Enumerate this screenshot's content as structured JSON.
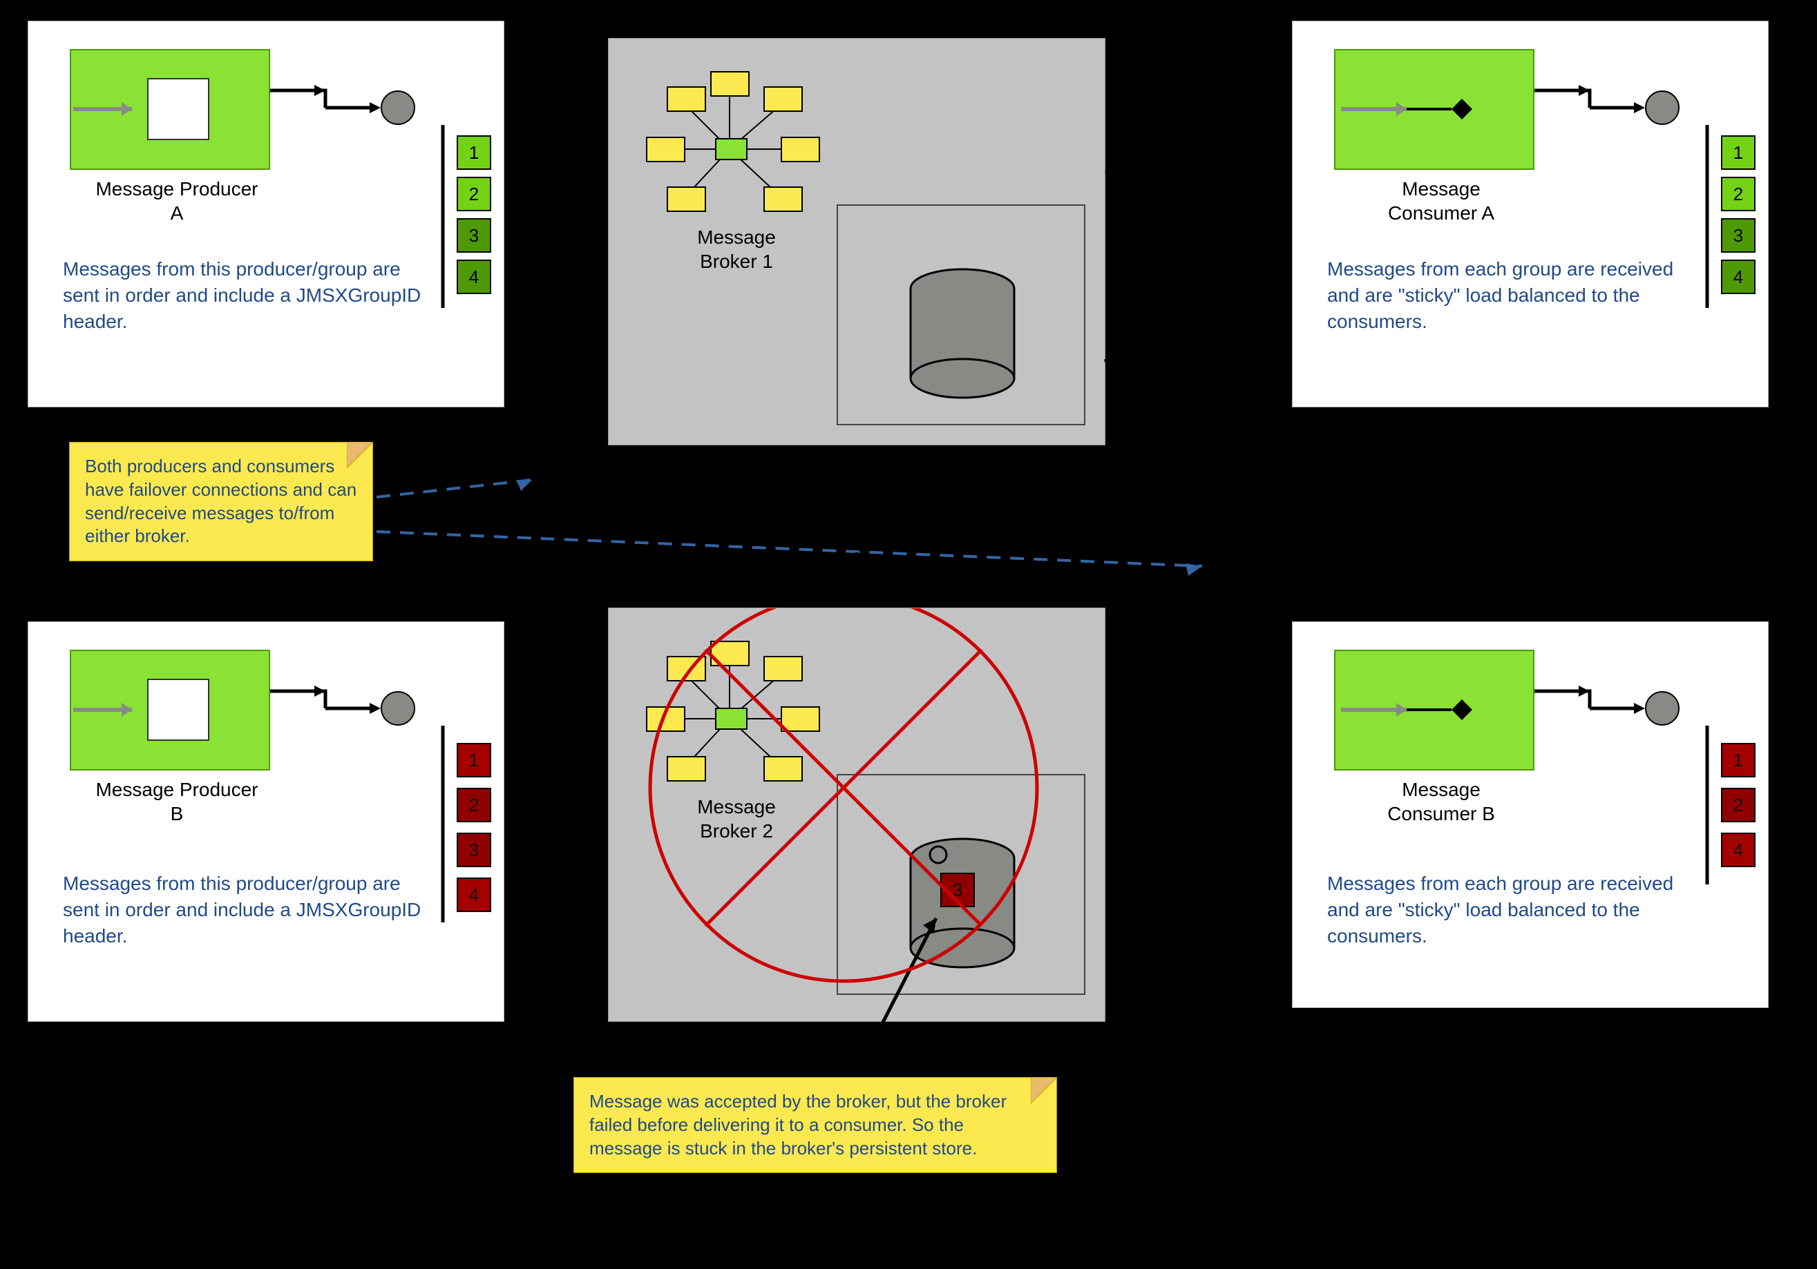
{
  "producerA": {
    "label1": "Message Producer",
    "label2": "A",
    "desc": "Messages from this producer/group are sent in order and include a JMSXGroupID header.",
    "badges": [
      "1",
      "2",
      "3",
      "4"
    ]
  },
  "producerB": {
    "label1": "Message Producer",
    "label2": "B",
    "desc": "Messages from this producer/group are sent in order and include a JMSXGroupID header.",
    "badges": [
      "1",
      "2",
      "3",
      "4"
    ]
  },
  "consumerA": {
    "label1": "Message",
    "label2": "Consumer A",
    "desc": "Messages from each group are received and are \"sticky\" load balanced to the consumers.",
    "badges": [
      "1",
      "2",
      "3",
      "4"
    ]
  },
  "consumerB": {
    "label1": "Message",
    "label2": "Consumer B",
    "desc": "Messages from each group are received and are \"sticky\" load balanced to the consumers.",
    "badges": [
      "1",
      "2",
      "4"
    ]
  },
  "broker1": {
    "label1": "Message",
    "label2": "Broker 1"
  },
  "broker2": {
    "label1": "Message",
    "label2": "Broker 2",
    "stuck_msg": "3"
  },
  "note_failover": "Both producers and consumers have failover connections and can send/receive messages to/from either broker.",
  "note_stuck": "Message was accepted by the broker, but the broker failed before delivering it to a consumer. So the message is stuck in the broker's persistent store.",
  "colors": {
    "green": "#8ae234",
    "red": "#a40000",
    "note": "#fce94f",
    "blue": "#204a87",
    "dash": "#3465a4",
    "failcircle": "#cc0000"
  }
}
